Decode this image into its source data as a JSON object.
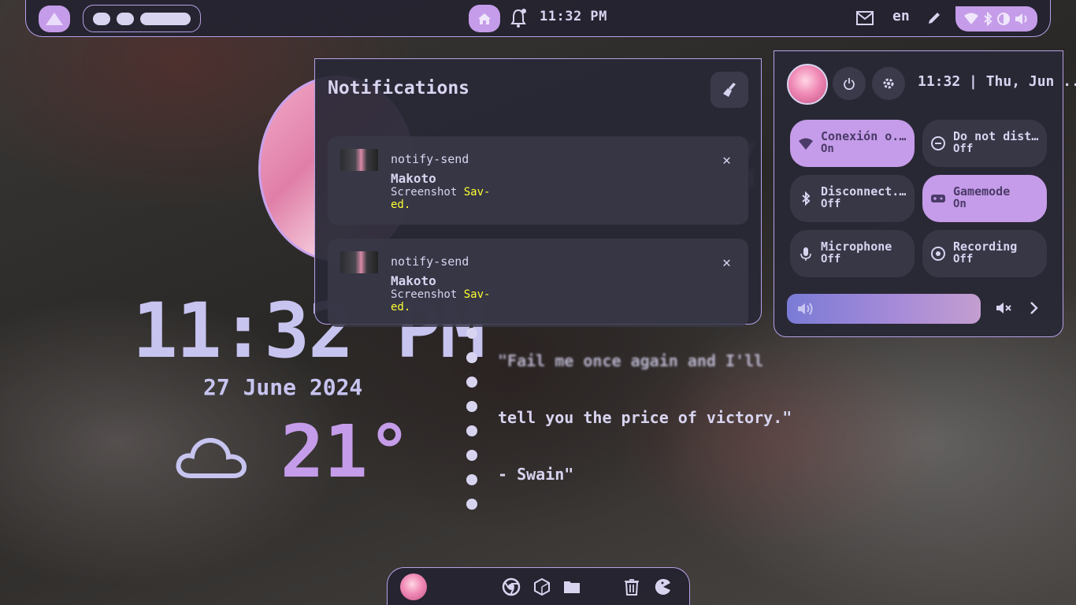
{
  "topbar": {
    "clock": "11:32 PM",
    "language": "en",
    "icons": [
      "launcher-icon",
      "home-icon",
      "bell-icon",
      "mail-icon",
      "pen-icon",
      "wifi-icon",
      "bluetooth-icon",
      "brightness-icon",
      "volume-icon"
    ]
  },
  "desktop": {
    "clock": "11:32 PM",
    "date": "27 June 2024",
    "temperature": "21°",
    "weather_icon": "cloud-icon",
    "quote_line1": "\"Fail me once again and I'll",
    "quote_line2": "tell you the price of victory.\"",
    "quote_line3": "- Swain\""
  },
  "notifications": {
    "title": "Notifications",
    "items": [
      {
        "app": "notify-send",
        "summary": "Makoto",
        "body_prefix": "Screenshot ",
        "body_highlight": "Sav-",
        "body_highlight2": "ed."
      },
      {
        "app": "notify-send",
        "summary": "Makoto",
        "body_prefix": "Screenshot ",
        "body_highlight": "Sav-",
        "body_highlight2": "ed."
      }
    ]
  },
  "quick_settings": {
    "time": "11:32 | Thu, Jun ...",
    "tiles": [
      {
        "name": "Conexión o...",
        "state": "On",
        "on": true,
        "icon": "wifi-icon"
      },
      {
        "name": "Do not distu...",
        "state": "Off",
        "on": false,
        "icon": "do-not-disturb-icon"
      },
      {
        "name": "Disconnect...",
        "state": "Off",
        "on": false,
        "icon": "bluetooth-icon"
      },
      {
        "name": "Gamemode",
        "state": "On",
        "on": true,
        "icon": "gamepad-icon"
      },
      {
        "name": "Microphone",
        "state": "Off",
        "on": false,
        "icon": "microphone-icon"
      },
      {
        "name": "Recording",
        "state": "Off",
        "on": false,
        "icon": "record-icon"
      }
    ],
    "volume_level": 1.0
  },
  "dock": {
    "apps": [
      "chrome-icon",
      "package-icon",
      "folder-icon",
      "trash-icon",
      "pacman-icon"
    ]
  },
  "colors": {
    "accent": "#c59ce9",
    "panel": "#28283a",
    "text": "#d8d4f0",
    "highlight": "#ffff33"
  }
}
